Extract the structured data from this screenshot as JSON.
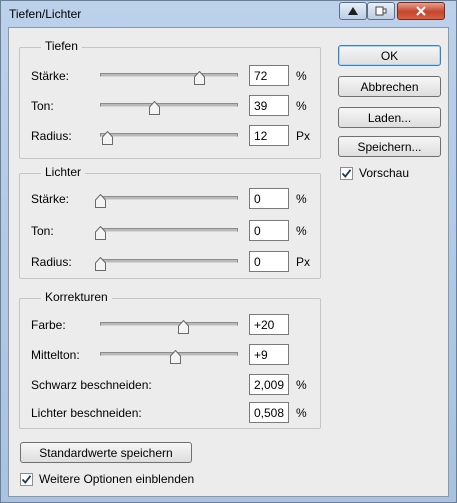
{
  "window": {
    "title": "Tiefen/Lichter"
  },
  "tiefen": {
    "title": "Tiefen",
    "rows": [
      {
        "label": "Stärke:",
        "value": "72",
        "unit": "%",
        "level": 0.72
      },
      {
        "label": "Ton:",
        "value": "39",
        "unit": "%",
        "level": 0.39
      },
      {
        "label": "Radius:",
        "value": "12",
        "unit": "Px",
        "level": 0.05
      }
    ]
  },
  "lichter": {
    "title": "Lichter",
    "rows": [
      {
        "label": "Stärke:",
        "value": "0",
        "unit": "%",
        "level": 0.0
      },
      {
        "label": "Ton:",
        "value": "0",
        "unit": "%",
        "level": 0.0
      },
      {
        "label": "Radius:",
        "value": "0",
        "unit": "Px",
        "level": 0.0
      }
    ]
  },
  "korrekturen": {
    "title": "Korrekturen",
    "farbe": {
      "label": "Farbe:",
      "value": "+20",
      "level": 0.6
    },
    "mittelton": {
      "label": "Mittelton:",
      "value": "+9",
      "level": 0.545
    },
    "schwarz": {
      "label": "Schwarz beschneiden:",
      "value": "2,009",
      "unit": "%"
    },
    "lichter": {
      "label": "Lichter beschneiden:",
      "value": "0,508",
      "unit": "%"
    }
  },
  "buttons": {
    "ok": "OK",
    "cancel": "Abbrechen",
    "load": "Laden...",
    "save": "Speichern..."
  },
  "preview": {
    "label": "Vorschau",
    "checked": true
  },
  "save_defaults": "Standardwerte speichern",
  "more_options": {
    "label": "Weitere Optionen einblenden",
    "checked": true
  },
  "colors": {
    "title_bar": "#bcd1ea",
    "close_button": "#c4452d",
    "dialog_bg": "#ececec",
    "default_button_border": "#3c7fb1"
  }
}
